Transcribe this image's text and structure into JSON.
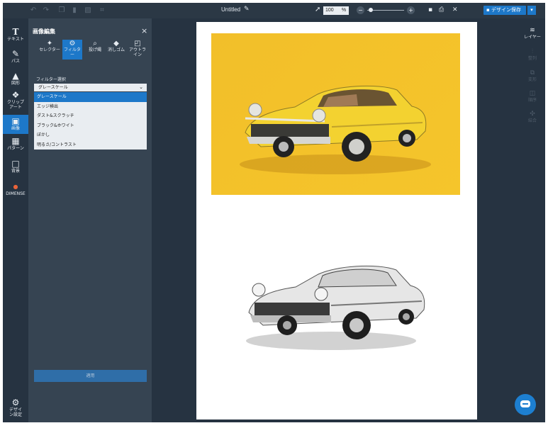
{
  "topbar": {
    "undo_icon": "undo-icon",
    "redo_icon": "redo-icon",
    "doc_title": "Untitled",
    "zoom_value": "100",
    "zoom_unit": "%",
    "zoom_out": "−",
    "zoom_in": "+",
    "save_label": "デザイン保存",
    "save_drop": "▾"
  },
  "left_sidebar": {
    "items": [
      {
        "label": "テキスト",
        "icon": "T"
      },
      {
        "label": "パス",
        "icon": "✎"
      },
      {
        "label": "図形",
        "icon": "▲"
      },
      {
        "label": "クリップアート",
        "icon": "❖"
      },
      {
        "label": "画像",
        "icon": "▣"
      },
      {
        "label": "パターン",
        "icon": "▦"
      },
      {
        "label": "背景",
        "icon": "□"
      },
      {
        "label": "DIMENSE",
        "icon": "●"
      }
    ],
    "settings_label": "デザイン設定"
  },
  "panel": {
    "title": "画像編集",
    "close": "×",
    "tools": [
      {
        "label": "セレクター",
        "icon": "✦"
      },
      {
        "label": "フィルター",
        "icon": "⚙"
      },
      {
        "label": "投げ縄",
        "icon": "⌕"
      },
      {
        "label": "消しゴム",
        "icon": "◆"
      },
      {
        "label": "アウトライン",
        "icon": "◰"
      }
    ],
    "filter_label": "フィルター選択",
    "filter_selected": "グレースケール",
    "filter_options": [
      "グレースケール",
      "エッジ検出",
      "ダスト&スクラッチ",
      "ブラック&ホワイト",
      "ぼかし",
      "明るさ/コントラスト"
    ],
    "apply_label": "適用"
  },
  "right_sidebar": {
    "items": [
      {
        "label": "レイヤー",
        "icon": "≋"
      },
      {
        "label": "整列",
        "icon": "⫶"
      },
      {
        "label": "変形",
        "icon": "⧉"
      },
      {
        "label": "順序",
        "icon": "◫"
      },
      {
        "label": "結合",
        "icon": "✣"
      }
    ]
  },
  "colors": {
    "accent": "#1d78c9",
    "sidebar": "#263341",
    "panel": "#364452",
    "photo_bg": "#f2bf2a"
  }
}
